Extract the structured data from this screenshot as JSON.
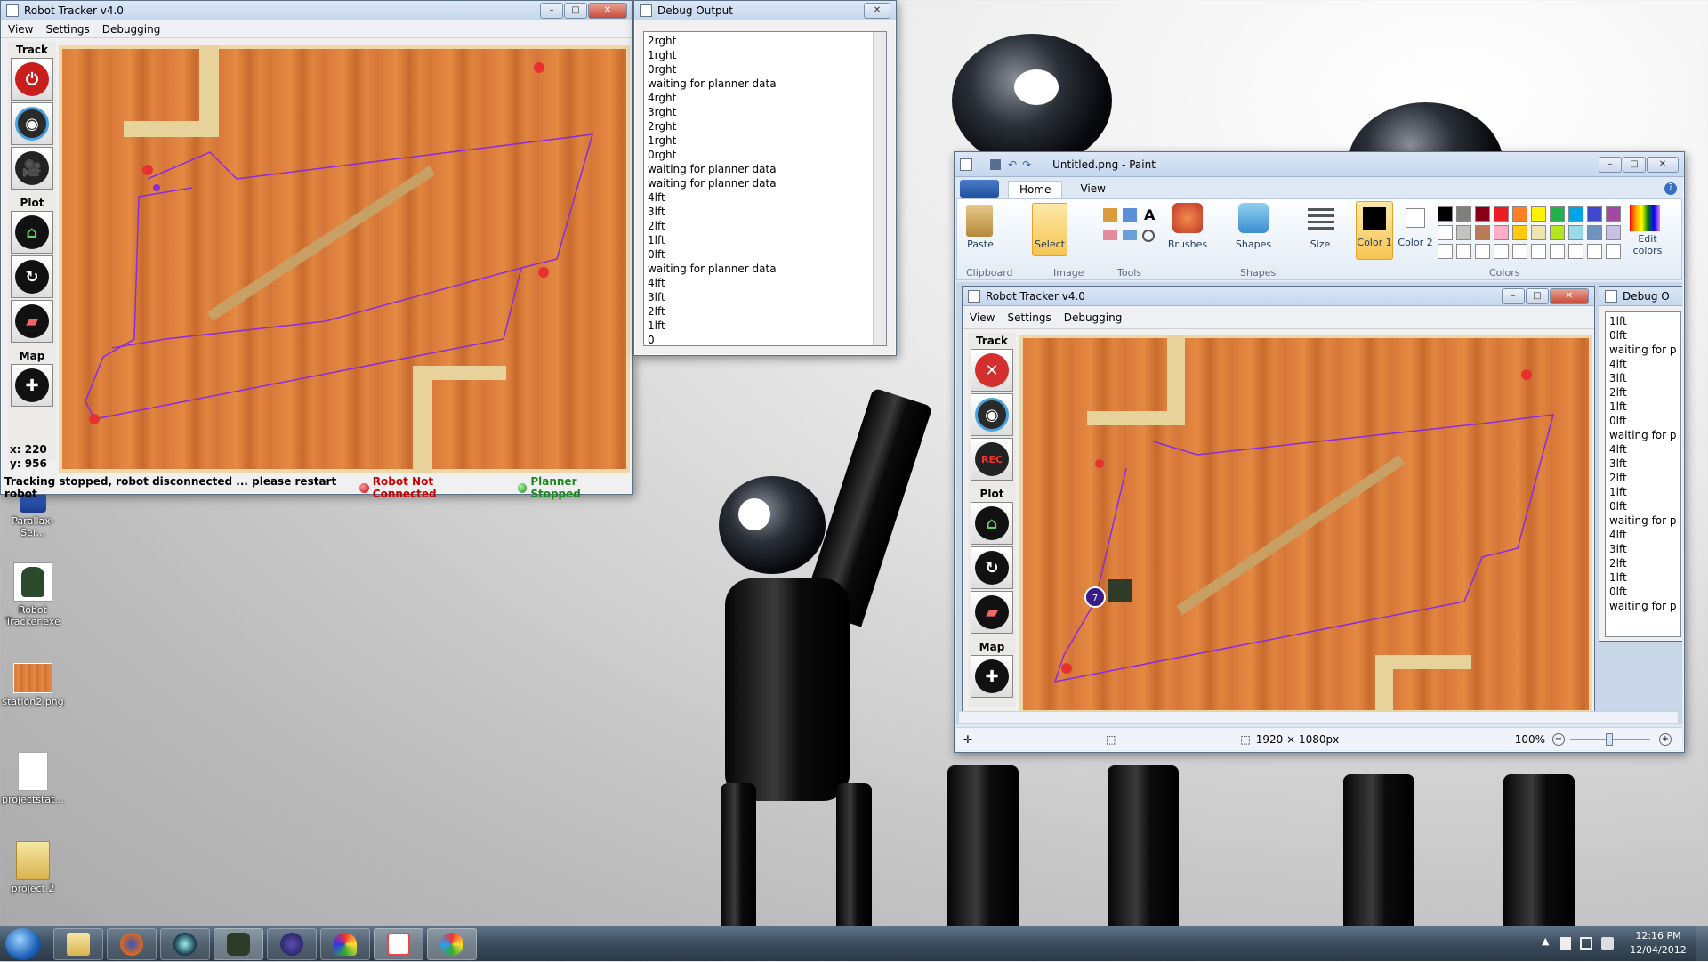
{
  "left_window": {
    "title": "Robot Tracker v4.0",
    "menu": [
      "View",
      "Settings",
      "Debugging"
    ],
    "groups": {
      "track": "Track",
      "plot": "Plot",
      "map": "Map"
    },
    "coords": {
      "x": "x: 220",
      "y": "y: 956"
    },
    "status_message": "Tracking stopped, robot disconnected ... please restart robot",
    "robot_status": "Robot Not Connected",
    "planner_status": "Planner Stopped"
  },
  "debug_window": {
    "title": "Debug Output",
    "lines": [
      "2rght",
      "1rght",
      "0rght",
      "waiting for planner data",
      "4rght",
      "3rght",
      "2rght",
      "1rght",
      "0rght",
      "waiting for planner data",
      "waiting for planner data",
      "4lft",
      "3lft",
      "2lft",
      "1lft",
      "0lft",
      "waiting for planner data",
      "4lft",
      "3lft",
      "2lft",
      "1lft",
      "0"
    ]
  },
  "paint_window": {
    "title": "Untitled.png - Paint",
    "tabs": [
      "Home",
      "View"
    ],
    "ribbon": {
      "paste": "Paste",
      "select": "Select",
      "brushes": "Brushes",
      "shapes": "Shapes",
      "size": "Size",
      "color1": "Color 1",
      "color2": "Color 2",
      "edit_colors": "Edit colors",
      "group_clipboard": "Clipboard",
      "group_image": "Image",
      "group_tools": "Tools",
      "group_shapes": "Shapes",
      "group_colors": "Colors"
    },
    "palette": [
      "#000000",
      "#7f7f7f",
      "#880015",
      "#ed1c24",
      "#ff7f27",
      "#fff200",
      "#22b14c",
      "#00a2e8",
      "#3f48cc",
      "#a349a4",
      "#ffffff",
      "#c3c3c3",
      "#b97a57",
      "#ffaec9",
      "#ffc90e",
      "#efe4b0",
      "#b5e61d",
      "#99d9ea",
      "#7092be",
      "#c8bfe7"
    ],
    "status": {
      "dimensions": "1920 × 1080px",
      "zoom": "100%"
    },
    "inner_tracker": {
      "title": "Robot Tracker v4.0",
      "menu": [
        "View",
        "Settings",
        "Debugging"
      ],
      "groups": {
        "track": "Track",
        "plot": "Plot",
        "map": "Map"
      },
      "robot_marker": "7"
    },
    "inner_debug": {
      "title": "Debug O",
      "lines": [
        "1lft",
        "0lft",
        "waiting for p",
        "4lft",
        "3lft",
        "2lft",
        "1lft",
        "0lft",
        "waiting for p",
        "4lft",
        "3lft",
        "2lft",
        "1lft",
        "0lft",
        "waiting for p",
        "4lft",
        "3lft",
        "2lft",
        "1lft",
        "0lft",
        "waiting for p"
      ]
    }
  },
  "desktop_icons": [
    {
      "label": "Parallax-Ser...",
      "icon": "usb-serial-icon"
    },
    {
      "label": "Robot Tracker.exe",
      "icon": "robot-icon"
    },
    {
      "label": "station2.png",
      "icon": "image-icon"
    },
    {
      "label": "projectstat...",
      "icon": "document-icon"
    },
    {
      "label": "project 2",
      "icon": "folder-icon"
    }
  ],
  "taskbar": {
    "time": "12:16 PM",
    "date": "12/04/2012",
    "apps": [
      "explorer",
      "firefox",
      "webcam",
      "robot-tracker",
      "eclipse",
      "umbrella",
      "java",
      "paint"
    ]
  },
  "colors": {
    "robot_not_connected": "#cc0000",
    "planner_stopped": "#1a8a1a",
    "path": "#8a2be2"
  }
}
